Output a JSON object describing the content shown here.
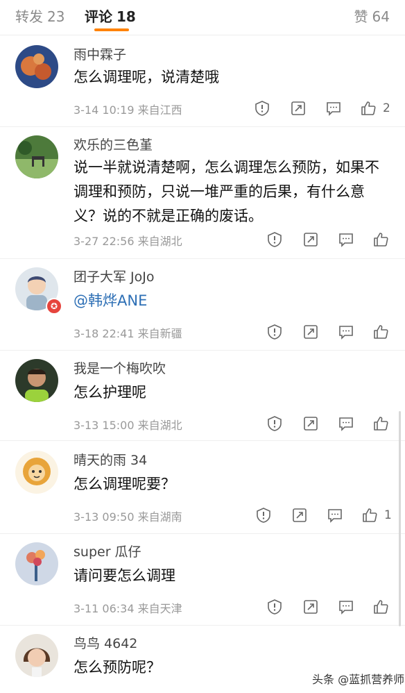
{
  "tabs": {
    "repost_label": "转发",
    "repost_count": "23",
    "comment_label": "评论",
    "comment_count": "18",
    "like_label": "赞",
    "like_count": "64"
  },
  "comments": [
    {
      "user": "雨中霖子",
      "text": "怎么调理呢，说清楚哦",
      "time": "3-14 10:19",
      "source": "来自江西",
      "likes": "2"
    },
    {
      "user": "欢乐的三色堇",
      "text": "说一半就说清楚啊，怎么调理怎么预防，如果不调理和预防，只说一堆严重的后果，有什么意义？说的不就是正确的废话。",
      "time": "3-27 22:56",
      "source": "来自湖北",
      "likes": ""
    },
    {
      "user": "团子大军 JoJo",
      "text": "@韩烨ANE",
      "time": "3-18 22:41",
      "source": "来自新疆",
      "likes": ""
    },
    {
      "user": "我是一个梅吹吹",
      "text": "怎么护理呢",
      "time": "3-13 15:00",
      "source": "来自湖北",
      "likes": ""
    },
    {
      "user": "晴天的雨 34",
      "text": "怎么调理呢要？",
      "time": "3-13 09:50",
      "source": "来自湖南",
      "likes": "1"
    },
    {
      "user": "super 瓜仔",
      "text": "请问要怎么调理",
      "time": "3-11 06:34",
      "source": "来自天津",
      "likes": ""
    },
    {
      "user": "鸟鸟 4642",
      "text": "怎么预防呢？",
      "time": "",
      "source": "",
      "likes": ""
    }
  ],
  "watermark": {
    "text": "头条 @蓝抓营养师"
  },
  "icons": {
    "report": "report-icon",
    "repost": "repost-icon",
    "comment": "comment-icon",
    "like": "like-icon"
  },
  "colors": {
    "accent": "#ff8200",
    "mention": "#2d6fb5",
    "meta": "#999999"
  }
}
